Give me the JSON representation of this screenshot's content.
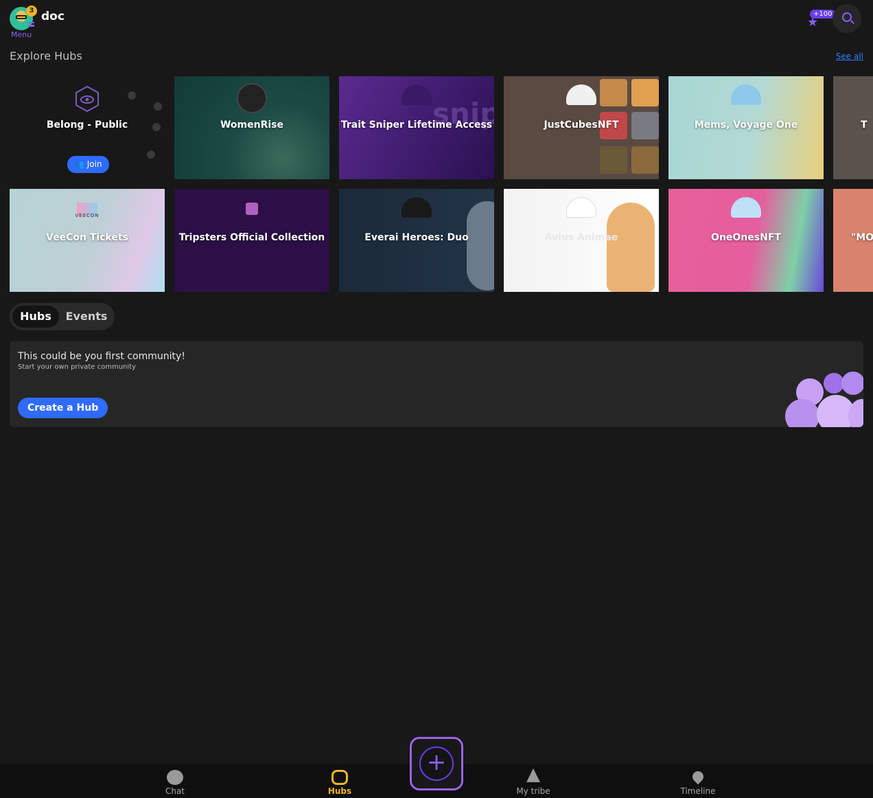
{
  "header": {
    "username": "doc",
    "menu_label": "Menu",
    "notification_count": "3",
    "points_label": "+100"
  },
  "explore": {
    "title": "Explore Hubs",
    "see_all": "See all"
  },
  "hubs": [
    {
      "name": "Belong - Public",
      "action": "Join"
    },
    {
      "name": "WomenRise"
    },
    {
      "name": "Trait Sniper Lifetime Access",
      "bg_text": "snipe"
    },
    {
      "name": "JustCubesNFT"
    },
    {
      "name": "Mems, Voyage One"
    },
    {
      "name": "T"
    },
    {
      "name": "VeeCon Tickets",
      "logo_text": "VEECON"
    },
    {
      "name": "Tripsters Official Collection"
    },
    {
      "name": "Everai Heroes: Duo"
    },
    {
      "name": "Avius Animae"
    },
    {
      "name": "OneOnesNFT"
    },
    {
      "name": "\"MOA"
    }
  ],
  "tabs": [
    "Hubs",
    "Events"
  ],
  "community": {
    "title": "This could be you first community!",
    "subtitle": "Start your own private community",
    "button": "Create a Hub"
  },
  "bottom_nav": [
    {
      "label": "Chat",
      "icon": "chat-icon"
    },
    {
      "label": "Hubs",
      "icon": "hub-icon",
      "active": true
    },
    {
      "label": "My tribe",
      "icon": "tribe-icon"
    },
    {
      "label": "Timeline",
      "icon": "location-pin-icon"
    }
  ],
  "colors": {
    "accent": "#8a5cf5",
    "primary_button": "#2f6bff",
    "active_nav": "#f0b429",
    "background": "#181818"
  }
}
